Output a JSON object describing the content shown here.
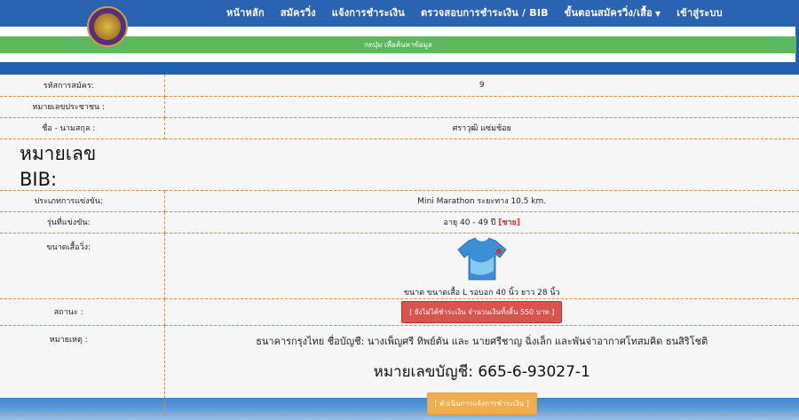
{
  "nav": {
    "items": [
      {
        "label": "หน้าหลัก"
      },
      {
        "label": "สมัครวิ่ง"
      },
      {
        "label": "แจ้งการชำระเงิน"
      },
      {
        "label": "ตรวจสอบการชำระเงิน / BIB"
      },
      {
        "label": "ขั้นตอนสมัครวิ่ง/เสื้อ",
        "caret": "▼"
      },
      {
        "label": "เข้าสู่ระบบ"
      }
    ]
  },
  "search": {
    "label": "กดปุ่ม เพื่อค้นหาข้อมูล"
  },
  "details": {
    "reg_no_label": "รหัสการสมัคร:",
    "reg_no_value": "9",
    "id_label": "หมายเลขประชาชน :",
    "id_value": "",
    "name_label": "ชื่อ - นามสกุล :",
    "name_value": "ศราวุฒิ  แซ่มช้อย",
    "bib_label": "หมายเลข BIB:",
    "type_label": "ประเภทการแข่งขัน:",
    "type_value": "Mini Marathon ระยะทาง 10.5 km.",
    "class_label": "รุ่นที่แข่งขัน:",
    "class_value": "อายุ 40 - 49 ปี",
    "class_gender": "[ชาย]",
    "shirt_label": "ขนาดเสื้อวิ่ง:",
    "shirt_value": "ขนาด ขนาดเสื้อ L รอบอก 40 นิ้ว ยาว 28 นิ้ว",
    "status_label": "สถานะ :",
    "status_value": "[ ยังไม่ได้ชำระเงิน จำนวนเงินทั้งสิ้น 550 บาท ]",
    "note_label": "หมายเหตุ :",
    "bank_line": "ธนาคารกรุงไทย ชื่อบัญชี: นางเพ็ญศรี ทิพย์ตัน และ นายศรีชาญ ฉิ่งเล็ก และพันจ่าอากาศโทสมคิด ธนสิริโชติ",
    "account_line": "หมายเลขบัญชี: 665-6-93027-1",
    "pay_button": "[ ดำเนินการแจ้งการชำระเงิน ]"
  },
  "colors": {
    "nav_bg": "#2a63b1",
    "search_green": "#5cb85c",
    "status_red": "#d9534f",
    "pay_orange": "#f0ad4e",
    "divider_orange": "#e58a3a"
  }
}
